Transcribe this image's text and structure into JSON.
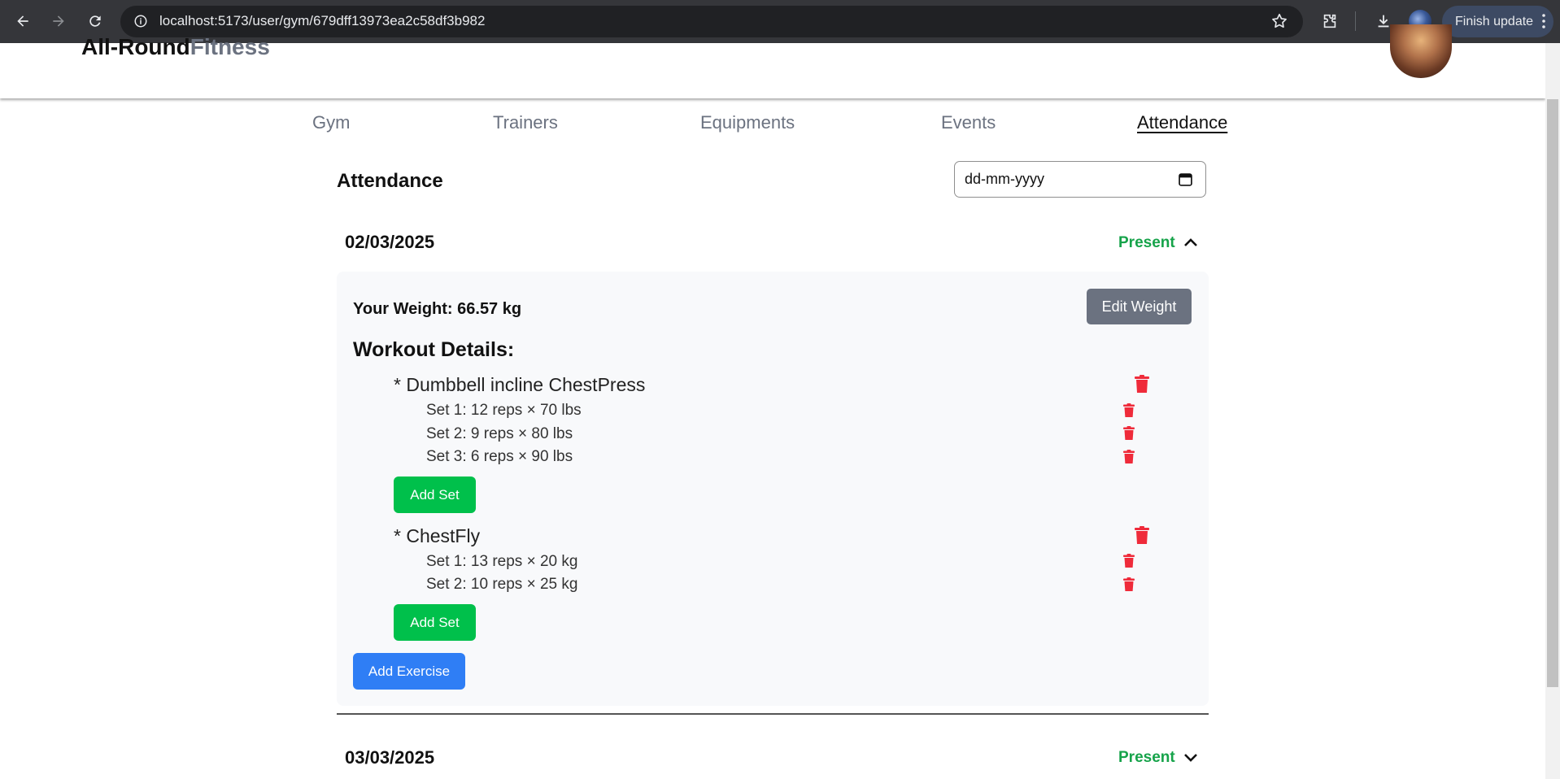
{
  "browser": {
    "url": "localhost:5173/user/gym/679dff13973ea2c58df3b982",
    "finish_update_label": "Finish update"
  },
  "app": {
    "brand_part1": "All-Round",
    "brand_part2": "Fitness"
  },
  "tabs": [
    {
      "label": "Gym",
      "active": false
    },
    {
      "label": "Trainers",
      "active": false
    },
    {
      "label": "Equipments",
      "active": false
    },
    {
      "label": "Events",
      "active": false
    },
    {
      "label": "Attendance",
      "active": true
    }
  ],
  "attendance": {
    "title": "Attendance",
    "date_placeholder": "dd-mm-yyyy",
    "days": [
      {
        "date": "02/03/2025",
        "status": "Present",
        "expanded": true,
        "weight_text": "Your Weight: 66.57 kg",
        "edit_weight_label": "Edit Weight",
        "workout_title": "Workout Details:",
        "exercises": [
          {
            "name": "* Dumbbell incline ChestPress",
            "sets": [
              "Set 1: 12 reps × 70 lbs",
              "Set 2: 9 reps × 80 lbs",
              "Set 3: 6 reps × 90 lbs"
            ],
            "add_set_label": "Add Set"
          },
          {
            "name": "* ChestFly",
            "sets": [
              "Set 1: 13 reps × 20 kg",
              "Set 2: 10 reps × 25 kg"
            ],
            "add_set_label": "Add Set"
          }
        ],
        "add_exercise_label": "Add Exercise"
      },
      {
        "date": "03/03/2025",
        "status": "Present",
        "expanded": false
      }
    ]
  },
  "colors": {
    "present": "#16a34a",
    "trash": "#ef2b3a",
    "add_set": "#00c04b",
    "add_exercise": "#2f7ef5",
    "edit_weight": "#6b7280"
  }
}
